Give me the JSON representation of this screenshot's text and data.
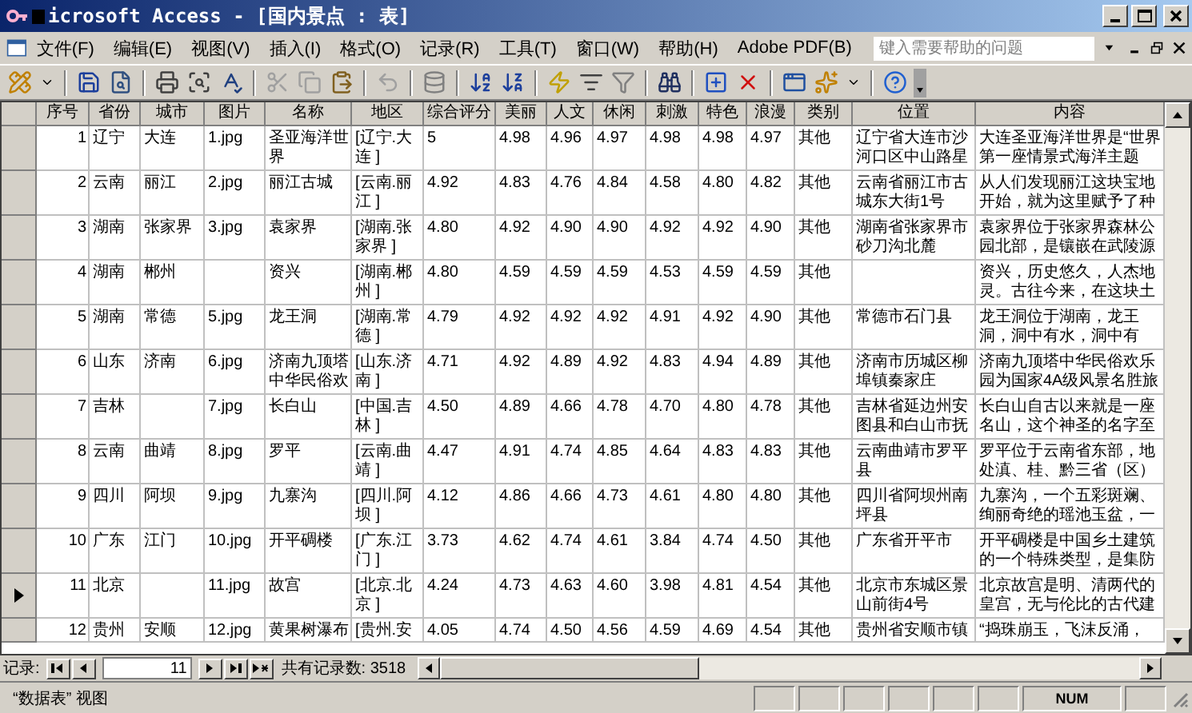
{
  "window": {
    "title": "icrosoft Access - [国内景点 : 表]"
  },
  "menus": [
    "文件(F)",
    "编辑(E)",
    "视图(V)",
    "插入(I)",
    "格式(O)",
    "记录(R)",
    "工具(T)",
    "窗口(W)",
    "帮助(H)",
    "Adobe PDF(B)"
  ],
  "help_box": {
    "placeholder": "键入需要帮助的问题"
  },
  "table": {
    "columns": [
      "序号",
      "省份",
      "城市",
      "图片",
      "名称",
      "地区",
      "综合评分",
      "美丽",
      "人文",
      "休闲",
      "刺激",
      "特色",
      "浪漫",
      "类别",
      "位置",
      "内容"
    ],
    "rows": [
      {
        "selected": false,
        "cells": [
          "1",
          "辽宁",
          "大连",
          "1.jpg",
          "圣亚海洋世界",
          "[辽宁.大连 ]",
          "5",
          "4.98",
          "4.96",
          "4.97",
          "4.98",
          "4.98",
          "4.97",
          "其他",
          "辽宁省大连市沙河口区中山路星",
          "大连圣亚海洋世界是“世界第一座情景式海洋主题"
        ]
      },
      {
        "selected": false,
        "cells": [
          "2",
          "云南",
          "丽江",
          "2.jpg",
          "丽江古城",
          "[云南.丽江 ]",
          "4.92",
          "4.83",
          "4.76",
          "4.84",
          "4.58",
          "4.80",
          "4.82",
          "其他",
          "云南省丽江市古城东大街1号",
          "从人们发现丽江这块宝地开始，就为这里赋予了种"
        ]
      },
      {
        "selected": false,
        "cells": [
          "3",
          "湖南",
          "张家界",
          "3.jpg",
          "袁家界",
          "[湖南.张家界 ]",
          "4.80",
          "4.92",
          "4.90",
          "4.90",
          "4.92",
          "4.92",
          "4.90",
          "其他",
          "湖南省张家界市砂刀沟北麓",
          "袁家界位于张家界森林公园北部，是镶嵌在武陵源"
        ]
      },
      {
        "selected": false,
        "cells": [
          "4",
          "湖南",
          "郴州",
          null,
          "资兴",
          "[湖南.郴州 ]",
          "4.80",
          "4.59",
          "4.59",
          "4.59",
          "4.53",
          "4.59",
          "4.59",
          "其他",
          null,
          "资兴，历史悠久，人杰地灵。古往今来，在这块土"
        ]
      },
      {
        "selected": false,
        "cells": [
          "5",
          "湖南",
          "常德",
          "5.jpg",
          "龙王洞",
          "[湖南.常德 ]",
          "4.79",
          "4.92",
          "4.92",
          "4.92",
          "4.91",
          "4.92",
          "4.90",
          "其他",
          "常德市石门县",
          "龙王洞位于湖南，龙王洞，洞中有水，洞中有"
        ]
      },
      {
        "selected": false,
        "cells": [
          "6",
          "山东",
          "济南",
          "6.jpg",
          "济南九顶塔中华民俗欢",
          "[山东.济南 ]",
          "4.71",
          "4.92",
          "4.89",
          "4.92",
          "4.83",
          "4.94",
          "4.89",
          "其他",
          "济南市历城区柳埠镇秦家庄",
          "济南九顶塔中华民俗欢乐园为国家4A级风景名胜旅"
        ]
      },
      {
        "selected": false,
        "cells": [
          "7",
          "吉林",
          null,
          "7.jpg",
          "长白山",
          "[中国.吉林 ]",
          "4.50",
          "4.89",
          "4.66",
          "4.78",
          "4.70",
          "4.80",
          "4.78",
          "其他",
          "吉林省延边州安图县和白山市抚",
          "长白山自古以来就是一座名山，这个神圣的名字至"
        ]
      },
      {
        "selected": false,
        "cells": [
          "8",
          "云南",
          "曲靖",
          "8.jpg",
          "罗平",
          "[云南.曲靖 ]",
          "4.47",
          "4.91",
          "4.74",
          "4.85",
          "4.64",
          "4.83",
          "4.83",
          "其他",
          "云南曲靖市罗平县",
          "罗平位于云南省东部，地处滇、桂、黔三省（区）"
        ]
      },
      {
        "selected": false,
        "cells": [
          "9",
          "四川",
          "阿坝",
          "9.jpg",
          "九寨沟",
          "[四川.阿坝 ]",
          "4.12",
          "4.86",
          "4.66",
          "4.73",
          "4.61",
          "4.80",
          "4.80",
          "其他",
          "四川省阿坝州南坪县",
          "九寨沟，一个五彩斑斓、绚丽奇绝的瑶池玉盆，一"
        ]
      },
      {
        "selected": false,
        "cells": [
          "10",
          "广东",
          "江门",
          "10.jpg",
          "开平碉楼",
          "[广东.江门 ]",
          "3.73",
          "4.62",
          "4.74",
          "4.61",
          "3.84",
          "4.74",
          "4.50",
          "其他",
          "广东省开平市",
          "开平碉楼是中国乡土建筑的一个特殊类型，是集防"
        ]
      },
      {
        "selected": true,
        "cells": [
          "11",
          "北京",
          null,
          "11.jpg",
          "故宫",
          "[北京.北京 ]",
          "4.24",
          "4.73",
          "4.63",
          "4.60",
          "3.98",
          "4.81",
          "4.54",
          "其他",
          "北京市东城区景山前街4号",
          "北京故宫是明、清两代的皇宫，无与伦比的古代建"
        ]
      },
      {
        "selected": false,
        "cells": [
          "12",
          "贵州",
          "安顺",
          "12.jpg",
          "黄果树瀑布",
          "[贵州.安",
          "4.05",
          "4.74",
          "4.50",
          "4.56",
          "4.59",
          "4.69",
          "4.54",
          "其他",
          "贵州省安顺市镇",
          "“捣珠崩玉，飞沫反涌，"
        ]
      }
    ]
  },
  "navigator": {
    "label": "记录:",
    "current": "11",
    "total": "共有记录数: 3518"
  },
  "status_bar": {
    "view": "“数据表” 视图",
    "indicator": "NUM"
  }
}
